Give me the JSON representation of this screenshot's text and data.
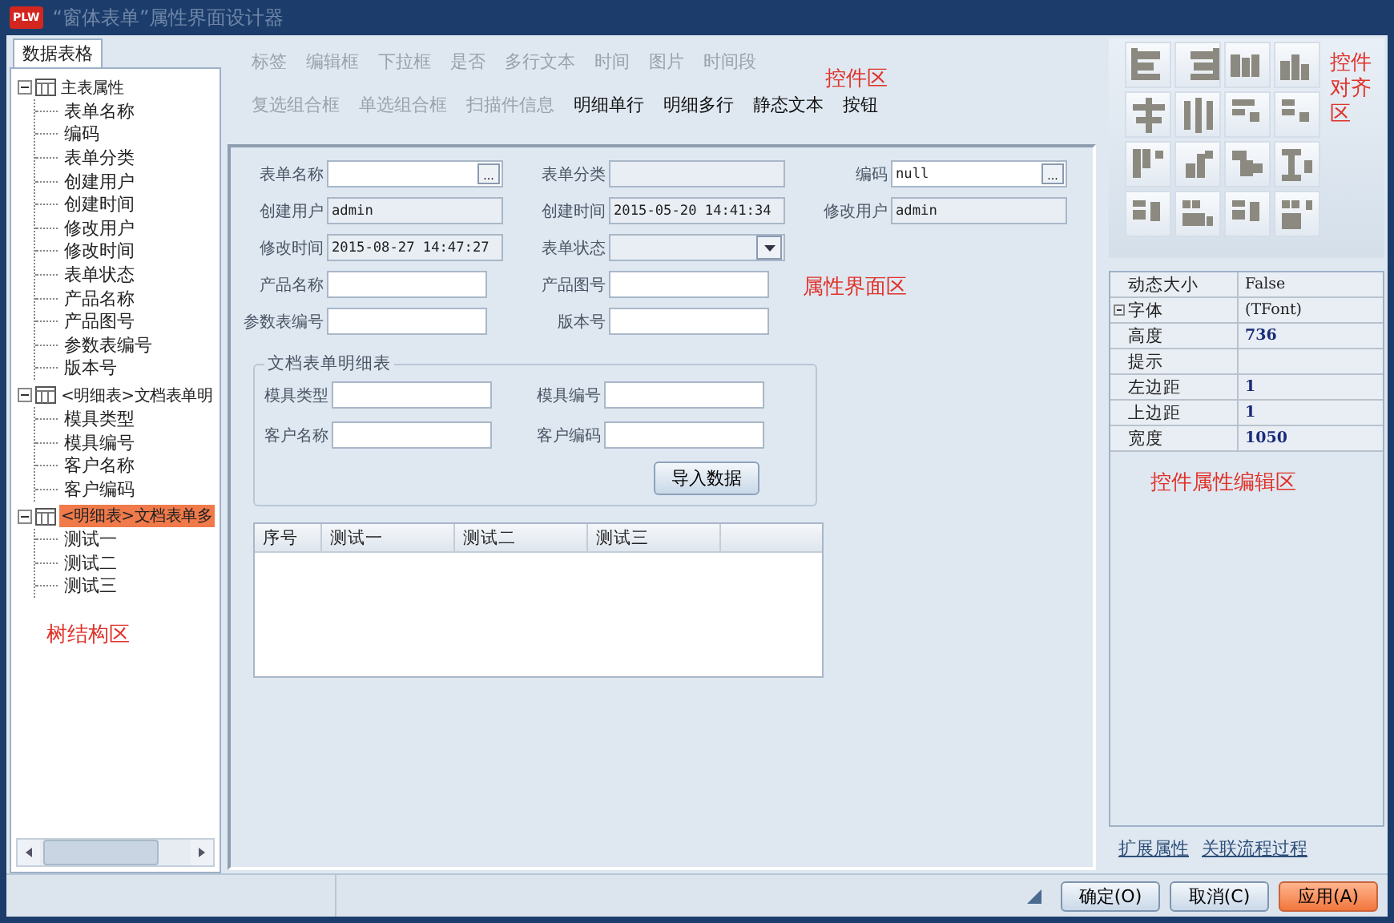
{
  "window": {
    "app_icon": "PLW",
    "title": "“窗体表单”属性界面设计器"
  },
  "tree_panel": {
    "tab": "数据表格",
    "annotation": "树结构区",
    "nodes": [
      {
        "label": "主表属性",
        "expanded": true,
        "selected": false,
        "children": [
          {
            "label": "表单名称"
          },
          {
            "label": "编码"
          },
          {
            "label": "表单分类"
          },
          {
            "label": "创建用户"
          },
          {
            "label": "创建时间"
          },
          {
            "label": "修改用户"
          },
          {
            "label": "修改时间"
          },
          {
            "label": "表单状态"
          },
          {
            "label": "产品名称"
          },
          {
            "label": "产品图号"
          },
          {
            "label": "参数表编号"
          },
          {
            "label": "版本号"
          }
        ]
      },
      {
        "label": "<明细表>文档表单明",
        "expanded": true,
        "selected": false,
        "children": [
          {
            "label": "模具类型"
          },
          {
            "label": "模具编号"
          },
          {
            "label": "客户名称"
          },
          {
            "label": "客户编码"
          }
        ]
      },
      {
        "label": "<明细表>文档表单多",
        "expanded": true,
        "selected": true,
        "children": [
          {
            "label": "测试一"
          },
          {
            "label": "测试二"
          },
          {
            "label": "测试三"
          }
        ]
      }
    ]
  },
  "control_palette": {
    "annotation": "控件区",
    "rows": [
      {
        "items": [
          {
            "label": "标签",
            "disabled": true
          },
          {
            "label": "编辑框",
            "disabled": true
          },
          {
            "label": "下拉框",
            "disabled": true
          },
          {
            "label": "是否",
            "disabled": true
          },
          {
            "label": "多行文本",
            "disabled": true
          },
          {
            "label": "时间",
            "disabled": true
          },
          {
            "label": "图片",
            "disabled": true
          },
          {
            "label": "时间段",
            "disabled": true
          }
        ]
      },
      {
        "items": [
          {
            "label": "复选组合框",
            "disabled": true
          },
          {
            "label": "单选组合框",
            "disabled": true
          },
          {
            "label": "扫描件信息",
            "disabled": true
          },
          {
            "label": "明细单行",
            "disabled": false
          },
          {
            "label": "明细多行",
            "disabled": false
          },
          {
            "label": "静态文本",
            "disabled": false
          },
          {
            "label": "按钮",
            "disabled": false
          }
        ]
      }
    ]
  },
  "designer": {
    "annotation": "属性界面区",
    "rows": [
      [
        {
          "label": "表单名称",
          "kind": "lookup",
          "button": "..."
        },
        {
          "label": "表单分类",
          "kind": "readonly"
        },
        {
          "label": "编码",
          "kind": "lookup",
          "value": "null",
          "button": "..."
        }
      ],
      [
        {
          "label": "创建用户",
          "kind": "readonly",
          "value": "admin"
        },
        {
          "label": "创建时间",
          "kind": "readonly",
          "value": "2015-05-20 14:41:34"
        },
        {
          "label": "修改用户",
          "kind": "readonly",
          "value": "admin"
        }
      ],
      [
        {
          "label": "修改时间",
          "kind": "readonly",
          "value": "2015-08-27 14:47:27"
        },
        {
          "label": "表单状态",
          "kind": "dropdown"
        }
      ],
      [
        {
          "label": "产品名称",
          "kind": "text"
        },
        {
          "label": "产品图号",
          "kind": "text"
        }
      ],
      [
        {
          "label": "参数表编号",
          "kind": "text"
        },
        {
          "label": "版本号",
          "kind": "text"
        }
      ]
    ],
    "group": {
      "title": "文档表单明细表",
      "rows": [
        [
          {
            "label": "模具类型",
            "kind": "text"
          },
          {
            "label": "模具编号",
            "kind": "text"
          }
        ],
        [
          {
            "label": "客户名称",
            "kind": "text"
          },
          {
            "label": "客户编码",
            "kind": "text"
          }
        ]
      ],
      "button": "导入数据"
    },
    "grid": {
      "columns": [
        "序号",
        "测试一",
        "测试二",
        "测试三"
      ]
    }
  },
  "alignment_panel": {
    "annotation": "控件对齐区"
  },
  "property_panel": {
    "annotation": "控件属性编辑区",
    "rows": [
      {
        "name": "动态大小",
        "value": "False",
        "expandable": false,
        "modified": false
      },
      {
        "name": "字体",
        "value": "(TFont)",
        "expandable": true,
        "modified": false
      },
      {
        "name": "高度",
        "value": "736",
        "expandable": false,
        "modified": true
      },
      {
        "name": "提示",
        "expandable": false
      },
      {
        "name": "左边距",
        "value": "1",
        "expandable": false,
        "modified": true
      },
      {
        "name": "上边距",
        "value": "1",
        "expandable": false,
        "modified": true
      },
      {
        "name": "宽度",
        "value": "1050",
        "expandable": false,
        "modified": true
      }
    ],
    "links": [
      "扩展属性",
      "关联流程过程"
    ]
  },
  "buttons": [
    {
      "label": "确定(O)",
      "primary": false
    },
    {
      "label": "取消(C)",
      "primary": false
    },
    {
      "label": "应用(A)",
      "primary": true
    }
  ]
}
